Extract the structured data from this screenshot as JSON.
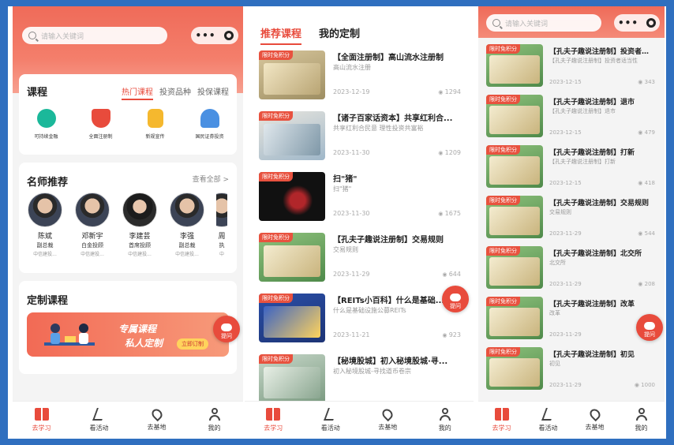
{
  "colors": {
    "accent": "#e84b3c",
    "header": "#ef6b59",
    "frame": "#2f6fbf"
  },
  "search": {
    "placeholder": "请输入关键词"
  },
  "capsule": {
    "dots": "•••"
  },
  "home": {
    "courses_title": "课程",
    "course_tabs": [
      "热门课程",
      "投资品种",
      "投保课程"
    ],
    "categories": [
      {
        "label": "可持续金融",
        "icon": "leaf-icon",
        "color": "#1bb89a"
      },
      {
        "label": "全面注册制",
        "icon": "shield-icon",
        "color": "#e84b3c"
      },
      {
        "label": "新规宣传",
        "icon": "document-icon",
        "color": "#f5b82e"
      },
      {
        "label": "国民证券投资",
        "icon": "person-icon",
        "color": "#4a90e2"
      }
    ],
    "teachers_title": "名师推荐",
    "view_all": "查看全部 >",
    "teachers": [
      {
        "name": "陈斌",
        "title": "副总裁",
        "company": "中信建投..."
      },
      {
        "name": "邓新宇",
        "title": "白金投顾",
        "company": "中信建投..."
      },
      {
        "name": "李建芸",
        "title": "首席投顾",
        "company": "中信建投..."
      },
      {
        "name": "李强",
        "title": "副总裁",
        "company": "中信建投..."
      },
      {
        "name": "周",
        "title": "执",
        "company": "中"
      }
    ],
    "custom_title": "定制课程",
    "banner": {
      "line1": "专属课程",
      "line2": "私人定制",
      "button": "立即订制"
    }
  },
  "ask_label": "提问",
  "tabbar": [
    {
      "label": "去学习",
      "icon": "book-icon"
    },
    {
      "label": "看活动",
      "icon": "party-icon"
    },
    {
      "label": "去基地",
      "icon": "location-pin-icon"
    },
    {
      "label": "我的",
      "icon": "user-icon"
    }
  ],
  "recommend": {
    "tabs": [
      "推荐课程",
      "我的定制"
    ],
    "tag": "限时免积分",
    "items": [
      {
        "title": "【全面注册制】高山流水注册制",
        "sub": "高山流水注册",
        "date": "2023-12-19",
        "views": "1294"
      },
      {
        "title": "【诸子百家话资本】共享红利合...",
        "sub": "共享红利合民意 理性投资共富裕",
        "date": "2023-11-30",
        "views": "1209"
      },
      {
        "title": "扫\"猪\"",
        "sub": "扫\"猪\"",
        "date": "2023-11-30",
        "views": "1675"
      },
      {
        "title": "【孔夫子趣说注册制】交易规则",
        "sub": "交易规则",
        "date": "2023-11-29",
        "views": "644"
      },
      {
        "title": "【REITs小百科】什么是基础...",
        "sub": "什么是基础设施公募REITs",
        "date": "2023-11-21",
        "views": "923"
      },
      {
        "title": "【秘境股城】初入秘境股城·寻...",
        "sub": "初入秘境股城-寻找道币卷宗",
        "date": "",
        "views": ""
      }
    ]
  },
  "series": {
    "tag": "限时免积分",
    "items": [
      {
        "title": "【孔夫子趣说注册制】投资者适...",
        "sub": "【孔夫子趣说注册制】投资者适当性",
        "date": "2023-12-15",
        "views": "343"
      },
      {
        "title": "【孔夫子趣说注册制】退市",
        "sub": "【孔夫子趣说注册制】退市",
        "date": "2023-12-15",
        "views": "479"
      },
      {
        "title": "【孔夫子趣说注册制】打新",
        "sub": "【孔夫子趣说注册制】打新",
        "date": "2023-12-15",
        "views": "418"
      },
      {
        "title": "【孔夫子趣说注册制】交易规则",
        "sub": "交易规则",
        "date": "2023-11-29",
        "views": "544"
      },
      {
        "title": "【孔夫子趣说注册制】北交所",
        "sub": "北交所",
        "date": "2023-11-29",
        "views": "208"
      },
      {
        "title": "【孔夫子趣说注册制】改革",
        "sub": "改革",
        "date": "2023-11-29",
        "views": ""
      },
      {
        "title": "【孔夫子趣说注册制】初见",
        "sub": "初见",
        "date": "2023-11-29",
        "views": "1000"
      }
    ]
  }
}
